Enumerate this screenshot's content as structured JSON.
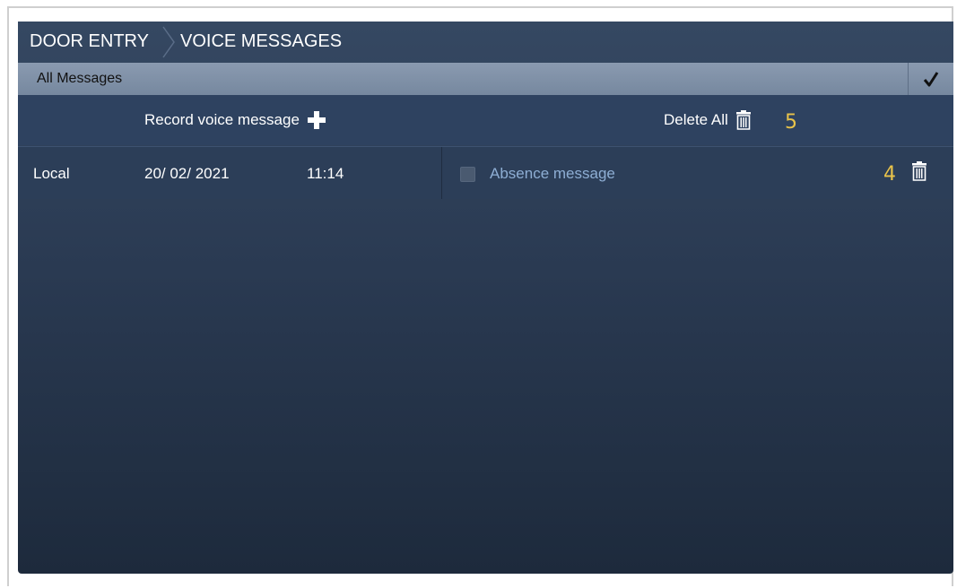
{
  "breadcrumb": {
    "section": "DOOR ENTRY",
    "page": "VOICE MESSAGES"
  },
  "filter_bar": {
    "label": "All Messages",
    "confirm_icon": "checkmark-icon"
  },
  "actions": {
    "record_label": "Record voice message",
    "record_icon": "plus-icon",
    "delete_all_label": "Delete All",
    "delete_all_icon": "trash-icon"
  },
  "messages": [
    {
      "source": "Local",
      "date": "20/ 02/ 2021",
      "time": "11:14",
      "checked": false,
      "label": "Absence message",
      "delete_icon": "trash-icon"
    }
  ],
  "callouts": {
    "row_delete": "4",
    "delete_all": "5"
  },
  "colors": {
    "panel_top": "#354862",
    "panel_bottom": "#1d2a3c",
    "filter_bar": "#8a9ab0",
    "message_label": "#8eaed4",
    "callout": "#e9c34a"
  }
}
